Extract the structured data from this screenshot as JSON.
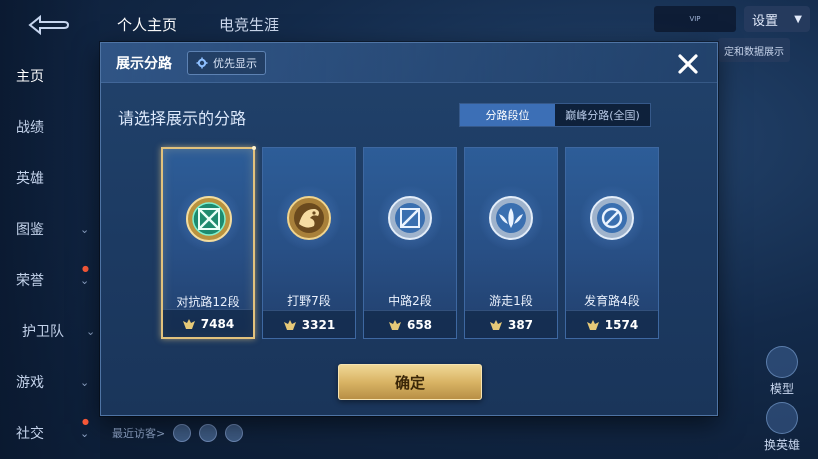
{
  "nav": {
    "items": [
      {
        "label": "主页"
      },
      {
        "label": "战绩"
      },
      {
        "label": "英雄"
      },
      {
        "label": "图鉴"
      },
      {
        "label": "荣誉"
      },
      {
        "label": "护卫队"
      },
      {
        "label": "游戏"
      },
      {
        "label": "社交"
      }
    ]
  },
  "top_tabs": [
    {
      "label": "个人主页"
    },
    {
      "label": "电竞生涯"
    }
  ],
  "header_right": {
    "settings_label": "设置",
    "strip_text": "定和数据展示"
  },
  "background": {
    "recent_visitors": "最近访客>",
    "model_label": "模型",
    "switch_hero_label": "换英雄"
  },
  "modal": {
    "title": "展示分路",
    "priority_label": "优先显示",
    "subtitle": "请选择展示的分路",
    "tabs": [
      {
        "label": "分路段位",
        "active": true
      },
      {
        "label": "巅峰分路(全国)",
        "active": false
      }
    ],
    "cards": [
      {
        "rank": "对抗路12段",
        "score": "7484",
        "selected": true,
        "icon": "clash-lane-icon"
      },
      {
        "rank": "打野7段",
        "score": "3321",
        "selected": false,
        "icon": "jungle-icon"
      },
      {
        "rank": "中路2段",
        "score": "658",
        "selected": false,
        "icon": "mid-lane-icon"
      },
      {
        "rank": "游走1段",
        "score": "387",
        "selected": false,
        "icon": "roam-icon"
      },
      {
        "rank": "发育路4段",
        "score": "1574",
        "selected": false,
        "icon": "farm-lane-icon"
      }
    ],
    "confirm_label": "确定"
  },
  "colors": {
    "accent_gold": "#e2c27d",
    "tab_active": "#3c6fb6",
    "modal_bg": "#1f3e66"
  }
}
